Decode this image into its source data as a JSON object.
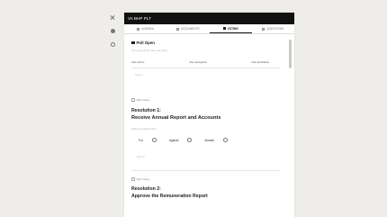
{
  "app": {
    "title": "VA BHP PLT"
  },
  "rail": {
    "icons": [
      "close-icon",
      "gear-icon",
      "circle-icon"
    ]
  },
  "tabs": [
    {
      "label": "AGENDA",
      "icon": "list-icon"
    },
    {
      "label": "DOCUMENTS",
      "icon": "document-icon"
    },
    {
      "label": "VOTING",
      "icon": "vote-icon",
      "active": true
    },
    {
      "label": "QUESTIONS",
      "icon": "question-icon"
    }
  ],
  "poll": {
    "status": "Poll Open",
    "hint": "You may submit your votes here",
    "tally": [
      "Vote all For",
      "Vote all Against",
      "Vote all Abstain"
    ],
    "submit_label": "Submit"
  },
  "resolutions": [
    {
      "toggle_label": "Split Voting",
      "number": "Resolution 1:",
      "title": "Receive Annual Report and Accounts",
      "choice_label": "Select a voting choice",
      "options": [
        "For",
        "Against",
        "Abstain"
      ],
      "vote_label": "Submit"
    },
    {
      "toggle_label": "Split Voting",
      "number": "Resolution 2:",
      "title": "Approve the Remuneration Report"
    }
  ]
}
